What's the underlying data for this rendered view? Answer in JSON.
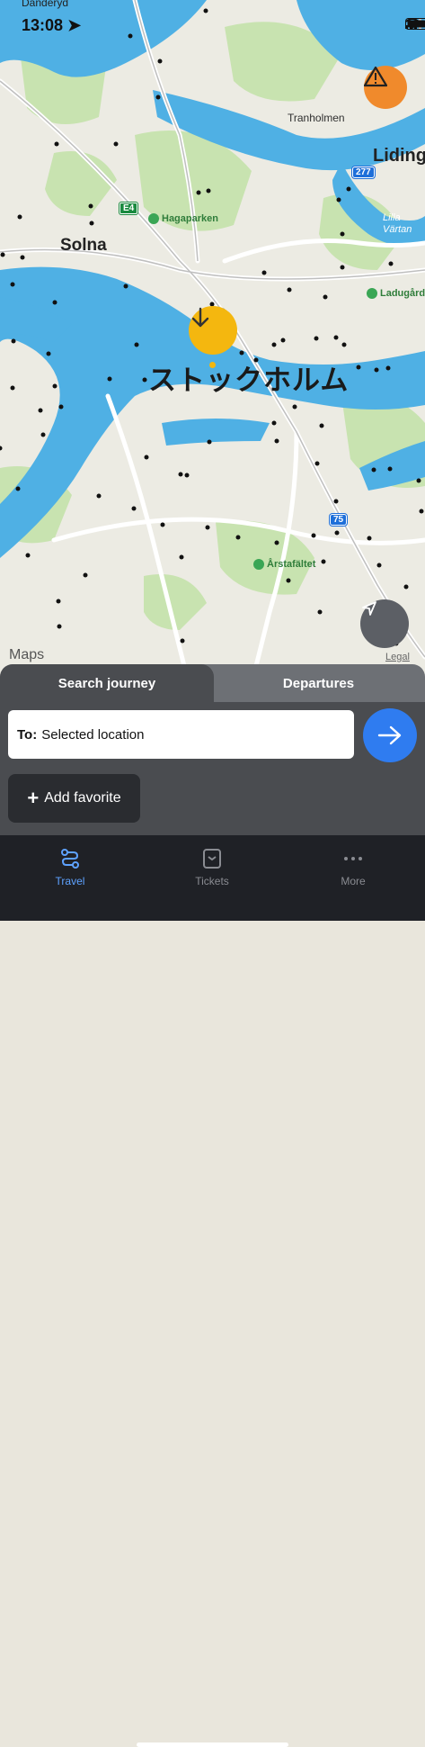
{
  "status": {
    "time": "13:08",
    "carrier_partial": "Danderyd"
  },
  "map": {
    "city_label": "ストックホルム",
    "places": {
      "solna": "Solna",
      "tranholmen": "Tranholmen",
      "lidingo": "Liding",
      "lilla_vartan": "Lilla\nVärtan",
      "hagaparken": "Hagaparken",
      "ladugard": "Ladugård",
      "arstafaltet": "Årstafältet"
    },
    "shields": {
      "e4": "E4",
      "r277": "277",
      "r75": "75"
    },
    "maps_logo": "Maps",
    "legal": "Legal",
    "colors": {
      "water": "#4fb0e4",
      "land": "#ecebe3",
      "park": "#c8e3b0",
      "road": "#ffffff",
      "pin": "#f4b70f",
      "warning": "#f08a2c"
    }
  },
  "panel": {
    "tab_search": "Search journey",
    "tab_departures": "Departures",
    "to_prefix": "To:",
    "to_value": "Selected location",
    "add_favorite": "Add favorite"
  },
  "tabbar": {
    "travel": "Travel",
    "tickets": "Tickets",
    "more": "More"
  }
}
